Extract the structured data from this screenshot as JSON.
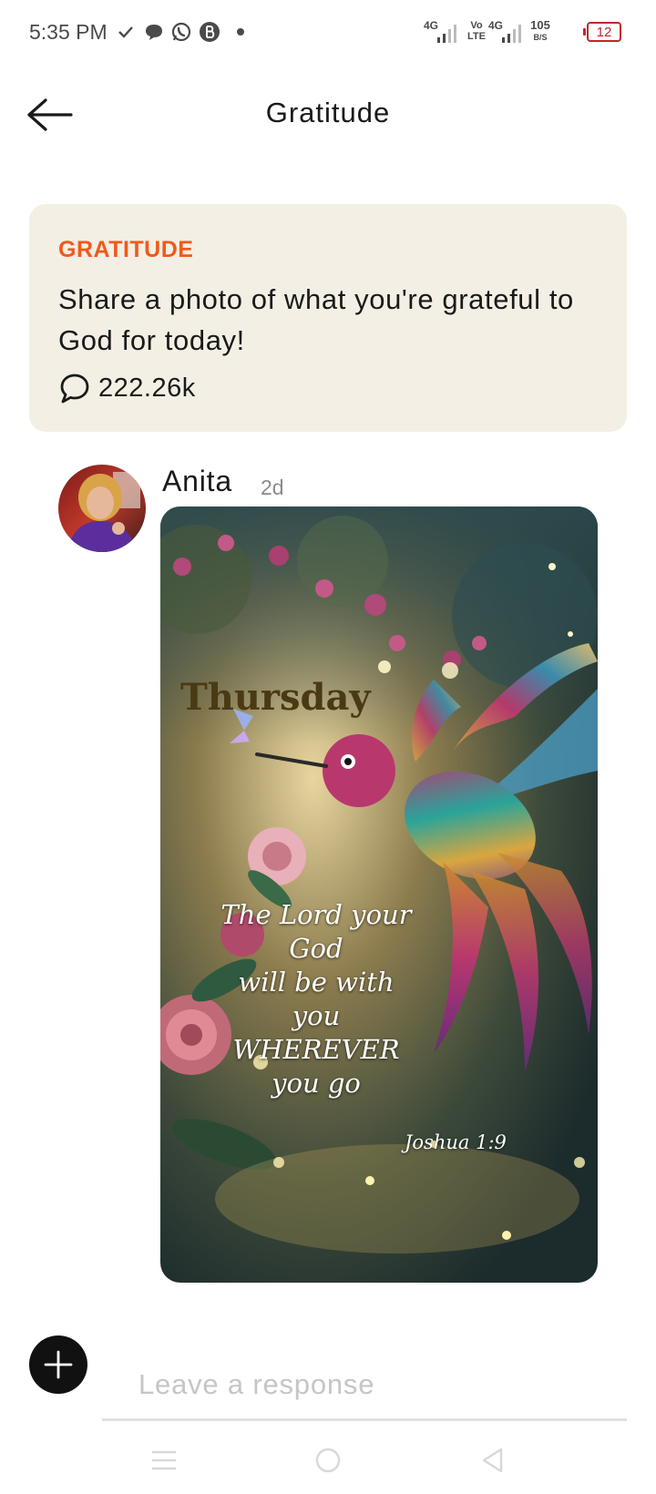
{
  "status_bar": {
    "time": "5:35 PM",
    "net1_label": "4G",
    "volte_label": "Vo LTE",
    "net2_label": "4G",
    "speed_value": "105",
    "speed_unit": "B/S",
    "battery_level": "12",
    "battery_color": "#c0262d",
    "icons": [
      "check-icon",
      "chat-bubble-icon",
      "whatsapp-icon",
      "b-badge-icon",
      "dot-icon",
      "signal-icon"
    ]
  },
  "header": {
    "title": "Gratitude",
    "back_icon": "arrow-left-icon"
  },
  "prompt_card": {
    "category": "GRATITUDE",
    "text": "Share a photo of what you're grateful to God for today!",
    "comment_count": "222.26k",
    "comment_icon": "speech-bubble-icon",
    "accent_color": "#f05a1a",
    "background_color": "#f3efe4"
  },
  "post": {
    "author": "Anita",
    "time_ago": "2d",
    "image": {
      "day_text": "Thursday",
      "verse_lines": [
        "The Lord your",
        "God",
        "will be with you",
        "WHEREVER",
        "you go"
      ],
      "reference": "Joshua 1:9"
    }
  },
  "composer": {
    "placeholder": "Leave a response",
    "add_icon": "plus-icon"
  },
  "system_nav": {
    "icons": [
      "menu-icon",
      "home-circle-icon",
      "back-triangle-icon"
    ]
  }
}
